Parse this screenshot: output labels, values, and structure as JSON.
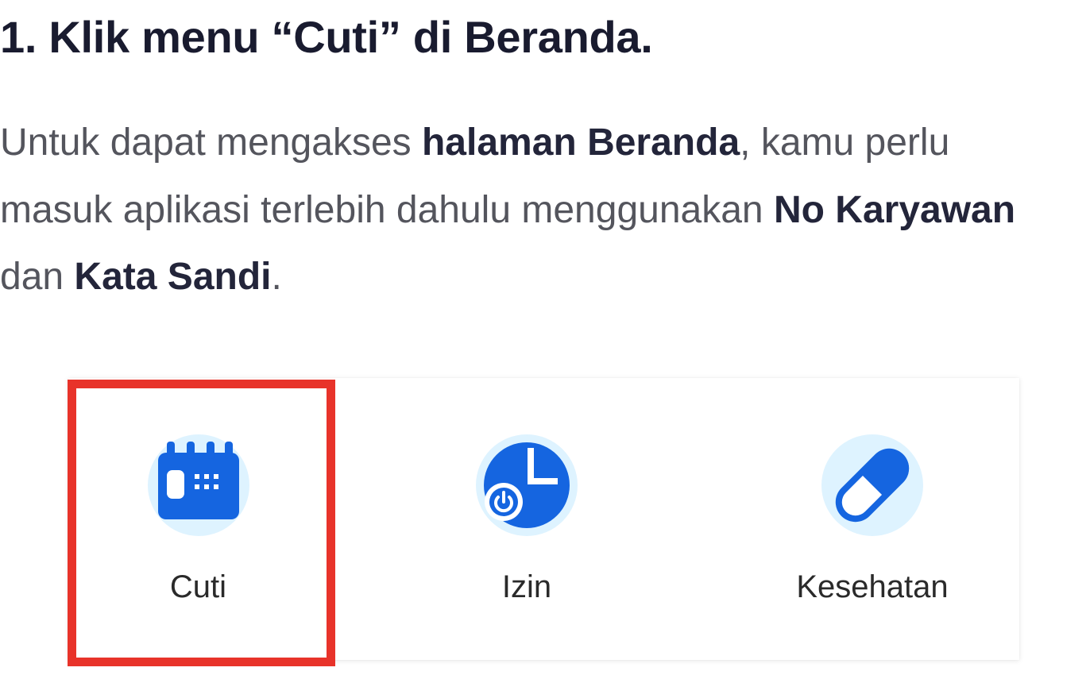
{
  "heading": "1. Klik menu “Cuti” di Beranda.",
  "paragraph": {
    "p1": "Untuk dapat mengakses ",
    "b1": "halaman Beranda",
    "p2": ", kamu perlu masuk aplikasi terlebih dahulu menggunakan ",
    "b2": "No Karyawan",
    "p3": " dan ",
    "b3": "Kata Sandi",
    "p4": "."
  },
  "menu": {
    "items": [
      {
        "label": "Cuti",
        "icon": "calendar-icon"
      },
      {
        "label": "Izin",
        "icon": "clock-power-icon"
      },
      {
        "label": "Kesehatan",
        "icon": "pill-capsule-icon"
      }
    ],
    "highlighted": "Cuti"
  },
  "colors": {
    "heading": "#191b2f",
    "body_text": "#54555d",
    "bold_text": "#23253a",
    "icon_blue": "#1565e0",
    "icon_circle_bg": "#def3ff",
    "highlight": "#e8332a"
  }
}
